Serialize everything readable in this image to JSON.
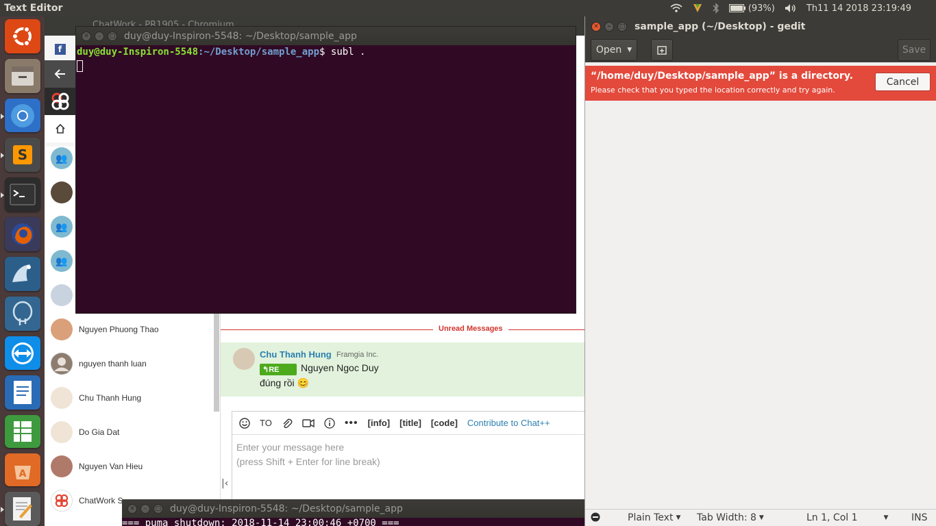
{
  "top_panel": {
    "app_title": "Text Editor",
    "battery": "(93%)",
    "clock": "Th11 14 2018 23:19:49"
  },
  "launcher": {
    "items": [
      {
        "name": "Ubuntu Dash",
        "icon": "ubuntu-logo-icon",
        "color": "#dd4814"
      },
      {
        "name": "Files",
        "icon": "files-icon",
        "color": "#8a7a6a"
      },
      {
        "name": "Chromium",
        "icon": "chromium-icon",
        "color": "#3b7ed0"
      },
      {
        "name": "Sublime Text",
        "icon": "sublime-icon",
        "color": "#4a4a4a"
      },
      {
        "name": "Terminal",
        "icon": "terminal-icon",
        "color": "#2c2c2c"
      },
      {
        "name": "Firefox",
        "icon": "firefox-icon",
        "color": "#e66000"
      },
      {
        "name": "MySQL Workbench",
        "icon": "mysql-workbench-icon",
        "color": "#2b5f8a"
      },
      {
        "name": "pgAdmin",
        "icon": "pgadmin-icon",
        "color": "#336791"
      },
      {
        "name": "TeamViewer",
        "icon": "teamviewer-icon",
        "color": "#0e8ee9"
      },
      {
        "name": "LibreOffice Writer",
        "icon": "libreoffice-writer-icon",
        "color": "#2a6bb5"
      },
      {
        "name": "LibreOffice Calc",
        "icon": "libreoffice-calc-icon",
        "color": "#3e9a3e"
      },
      {
        "name": "Ubuntu Software",
        "icon": "software-center-icon",
        "color": "#e06a26"
      },
      {
        "name": "Text Editor",
        "icon": "gedit-icon",
        "color": "#5a5a5a"
      }
    ]
  },
  "chromium": {
    "title": "ChatWork - PR1905 - Chromium",
    "rooms": [
      {
        "name": "",
        "avatar": "group"
      },
      {
        "name": "",
        "avatar": "person"
      },
      {
        "name": "",
        "avatar": "group"
      },
      {
        "name": "",
        "avatar": "group"
      },
      {
        "name": "",
        "avatar": "person"
      },
      {
        "name": "Nguyen Phuong Thao",
        "avatar": "person"
      },
      {
        "name": "nguyen thanh luan",
        "avatar": "default"
      },
      {
        "name": "Chu Thanh Hung",
        "avatar": "person"
      },
      {
        "name": "Do Gia Dat",
        "avatar": "person"
      },
      {
        "name": "Nguyen Van Hieu",
        "avatar": "person"
      },
      {
        "name": "ChatWork S",
        "avatar": "chatwork"
      }
    ],
    "unread_label": "Unread Messages",
    "message": {
      "sender": "Chu Thanh Hung",
      "org": "Framgia Inc.",
      "re_label": "RE",
      "reply_to": "Nguyen Ngoc Duy",
      "text": "đúng rồi 😊"
    },
    "composer": {
      "to_label": "TO",
      "info_tag": "[info]",
      "title_tag": "[title]",
      "code_tag": "[code]",
      "contribute_link": "Contribute to Chat++",
      "placeholder_line1": "Enter your message here",
      "placeholder_line2": "(press Shift + Enter for line break)"
    }
  },
  "terminal": {
    "title": "duy@duy-Inspiron-5548: ~/Desktop/sample_app",
    "prompt_user": "duy@duy-Inspiron-5548",
    "prompt_path": ":~/Desktop/sample_app",
    "command": "$ subl ."
  },
  "terminal2": {
    "title": "duy@duy-Inspiron-5548: ~/Desktop/sample_app",
    "line": "=== puma shutdown: 2018-11-14 23:00:46 +0700 ==="
  },
  "gedit": {
    "title": "sample_app (~/Desktop) - gedit",
    "open_label": "Open",
    "save_label": "Save",
    "error_title": "“/home/duy/Desktop/sample_app” is a directory.",
    "error_detail": "Please check that you typed the location correctly and try again.",
    "cancel_label": "Cancel",
    "status": {
      "language": "Plain Text",
      "tab_width": "Tab Width: 8",
      "position": "Ln 1, Col 1",
      "mode": "INS"
    }
  }
}
